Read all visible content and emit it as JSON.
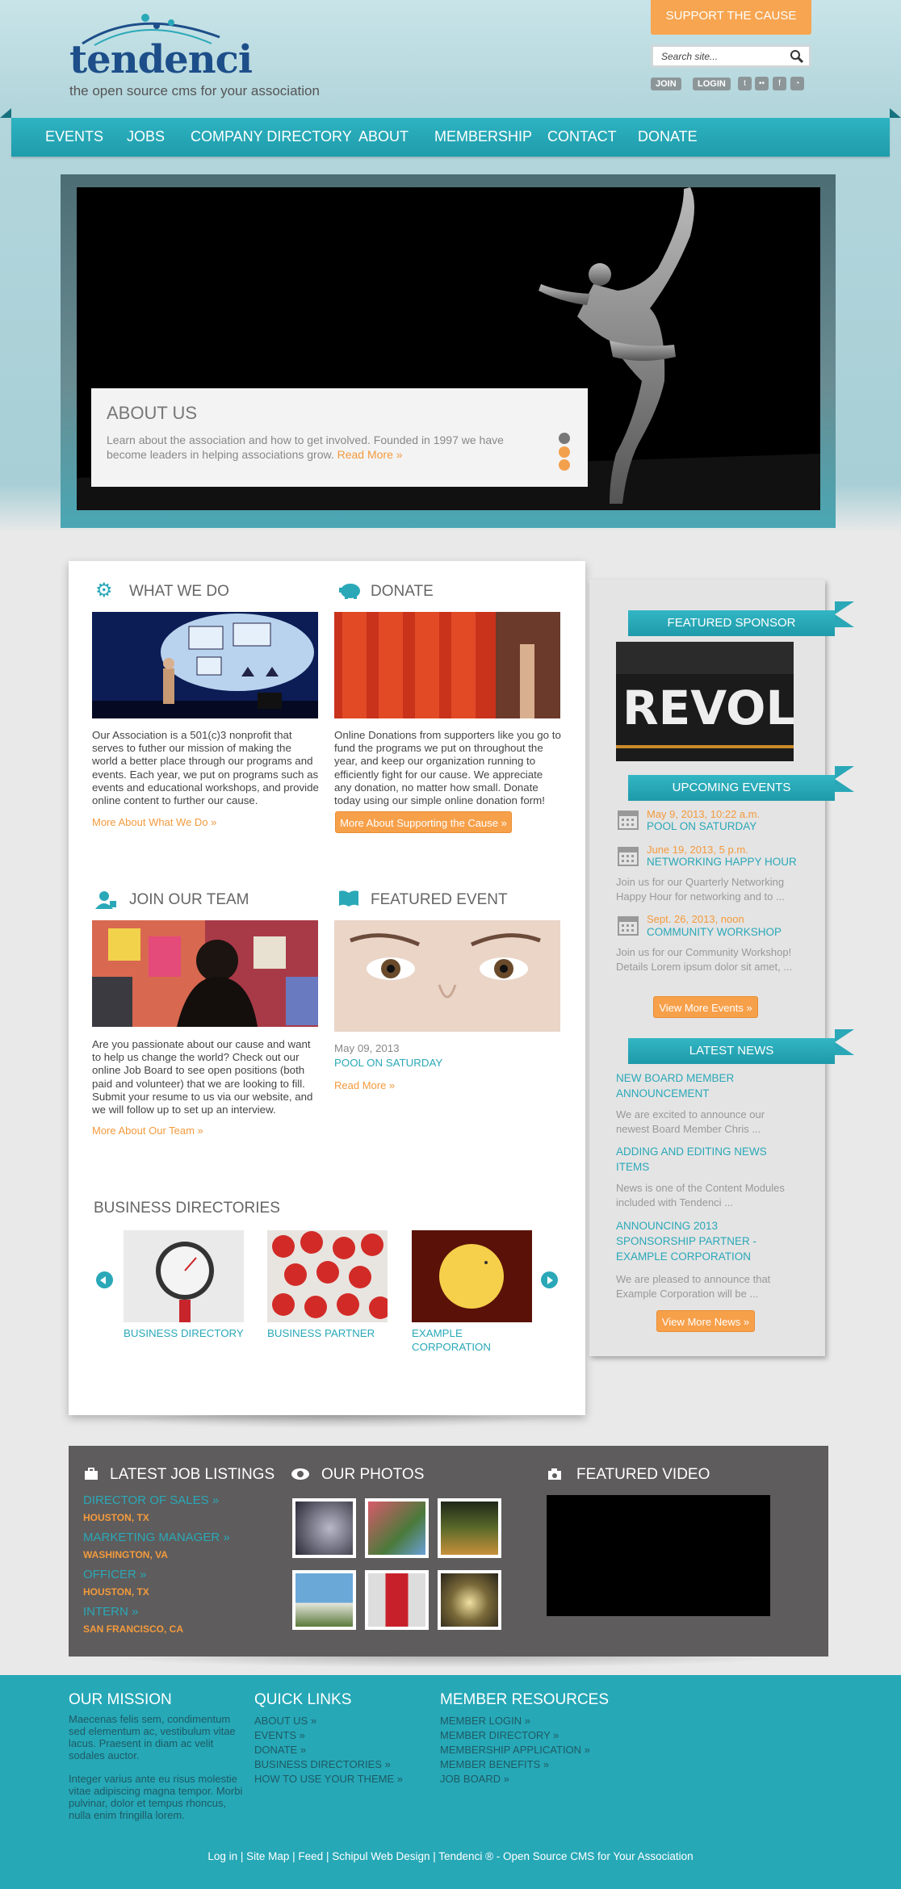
{
  "header": {
    "logo_text": "tendenci",
    "tagline": "the open source cms for your association",
    "support_label": "SUPPORT THE CAUSE",
    "search_placeholder": "Search site...",
    "join_label": "JOIN",
    "login_label": "LOGIN",
    "social_icons": [
      "tumblr-icon",
      "flickr-icon",
      "facebook-icon",
      "rss-icon"
    ]
  },
  "nav": [
    "EVENTS",
    "JOBS",
    "COMPANY DIRECTORY",
    "ABOUT",
    "MEMBERSHIP",
    "CONTACT",
    "DONATE"
  ],
  "slider": {
    "title": "ABOUT US",
    "text": "Learn about the association and how to get involved. Founded in 1997 we have become leaders in helping associations grow.",
    "link": "Read More »"
  },
  "what_we_do": {
    "title": "WHAT WE DO",
    "text": "Our Association is a 501(c)3 nonprofit that serves to futher our mission of making the world a better place through our programs and events. Each year, we put on programs such as events and educational workshops, and provide online content to further our cause.",
    "link": "More About What We Do »"
  },
  "donate": {
    "title": "DONATE",
    "text": "Online Donations from supporters like you go to fund the programs we put on throughout the year, and keep our organization running to efficiently fight for our cause. We appreciate any donation, no matter how small. Donate today using our simple online donation form!",
    "button": "More About Supporting the Cause »"
  },
  "join_team": {
    "title": "JOIN OUR TEAM",
    "text": "Are you passionate about our cause and want to help us change the world? Check out our online Job Board to see open positions (both paid and volunteer) that we are looking to fill. Submit your resume to us via our website, and we will follow up to set up an interview.",
    "link": "More About Our Team »"
  },
  "featured_event": {
    "title": "FEATURED EVENT",
    "date": "May 09, 2013",
    "name": "POOL ON SATURDAY",
    "link": "Read More »"
  },
  "business": {
    "title": "BUSINESS DIRECTORIES",
    "items": [
      "BUSINESS DIRECTORY",
      "BUSINESS PARTNER",
      "EXAMPLE CORPORATION"
    ]
  },
  "sidebar": {
    "sponsor_title": "FEATURED SPONSOR",
    "sponsor_image_text": "REVOLUTION",
    "events_title": "UPCOMING EVENTS",
    "events": [
      {
        "date": "May 9, 2013, 10:22 a.m.",
        "name": "POOL ON SATURDAY",
        "desc": ""
      },
      {
        "date": "June 19, 2013, 5 p.m.",
        "name": "NETWORKING HAPPY HOUR",
        "desc": "Join us for our Quarterly Networking Happy Hour for networking and to ..."
      },
      {
        "date": "Sept. 26, 2013, noon",
        "name": "COMMUNITY WORKSHOP",
        "desc": "Join us for our Community Workshop! Details Lorem ipsum dolor sit amet, ..."
      }
    ],
    "events_button": "View More Events »",
    "news_title": "LATEST NEWS",
    "news": [
      {
        "title": "NEW BOARD MEMBER ANNOUNCEMENT",
        "desc": "We are excited to announce our newest Board Member Chris ..."
      },
      {
        "title": "ADDING AND EDITING NEWS ITEMS",
        "desc": "News is one of the Content Modules included with Tendenci ..."
      },
      {
        "title": "ANNOUNCING 2013 SPONSORSHIP PARTNER - EXAMPLE CORPORATION",
        "desc": "We are pleased to announce that Example Corporation will be ..."
      }
    ],
    "news_button": "View More News »"
  },
  "jobs": {
    "title": "LATEST JOB LISTINGS",
    "items": [
      {
        "title": "DIRECTOR OF SALES »",
        "loc": "HOUSTON, TX"
      },
      {
        "title": "MARKETING MANAGER »",
        "loc": "WASHINGTON, VA"
      },
      {
        "title": "OFFICER »",
        "loc": "HOUSTON, TX"
      },
      {
        "title": "INTERN »",
        "loc": "SAN FRANCISCO, CA"
      }
    ]
  },
  "photos": {
    "title": "OUR PHOTOS"
  },
  "video": {
    "title": "FEATURED VIDEO"
  },
  "footer": {
    "mission_title": "OUR MISSION",
    "mission_p1": "Maecenas felis sem, condimentum sed elementum ac, vestibulum vitae lacus. Praesent in diam ac velit sodales auctor.",
    "mission_p2": "Integer varius ante eu risus molestie vitae adipiscing magna tempor. Morbi pulvinar, dolor et tempus rhoncus, nulla enim fringilla lorem.",
    "quick_title": "QUICK LINKS",
    "quick": [
      "ABOUT US »",
      "EVENTS »",
      "DONATE »",
      "BUSINESS DIRECTORIES »",
      "HOW TO USE YOUR THEME »"
    ],
    "member_title": "MEMBER RESOURCES",
    "member": [
      "MEMBER LOGIN »",
      "MEMBER DIRECTORY »",
      "MEMBERSHIP APPLICATION »",
      "MEMBER BENEFITS »",
      "JOB BOARD »"
    ],
    "bottom": "Log in | Site Map | Feed | Schipul Web Design | Tendenci ® - Open Source CMS for Your Association"
  }
}
